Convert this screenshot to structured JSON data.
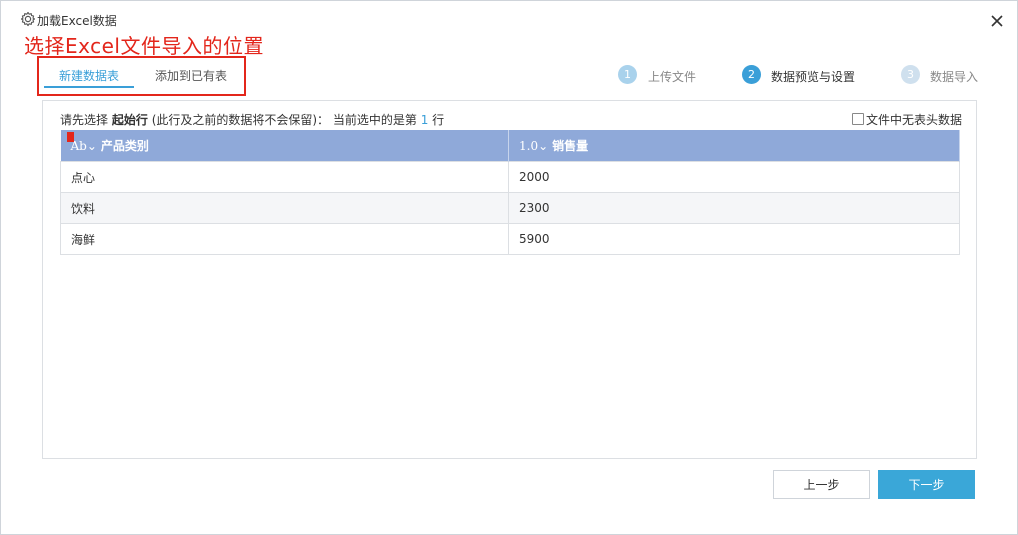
{
  "window": {
    "title": "加载Excel数据"
  },
  "annotation": "选择Excel文件导入的位置",
  "tabs": [
    {
      "label": "新建数据表",
      "active": true
    },
    {
      "label": "添加到已有表",
      "active": false
    }
  ],
  "steps": [
    {
      "num": "1",
      "label": "上传文件",
      "state": "done"
    },
    {
      "num": "2",
      "label": "数据预览与设置",
      "state": "active"
    },
    {
      "num": "3",
      "label": "数据导入",
      "state": "pending"
    }
  ],
  "hint": {
    "prefix": "请先选择",
    "bold": "起始行",
    "middle": "(此行及之前的数据将不会保留)： 当前选中的是第",
    "row": "1",
    "suffix": "行"
  },
  "no_header_checkbox": {
    "label": "文件中无表头数据",
    "checked": false
  },
  "table": {
    "columns": [
      {
        "type": "Ab⌄",
        "name": "产品类别"
      },
      {
        "type": "1.0⌄",
        "name": "销售量"
      }
    ],
    "rows": [
      [
        "点心",
        "2000"
      ],
      [
        "饮料",
        "2300"
      ],
      [
        "海鲜",
        "5900"
      ]
    ]
  },
  "buttons": {
    "prev": "上一步",
    "next": "下一步"
  },
  "colors": {
    "accent": "#3aa7d8",
    "header": "#8fa9d9",
    "annotation": "#e3261b",
    "step_done": "#a9d2ec"
  }
}
